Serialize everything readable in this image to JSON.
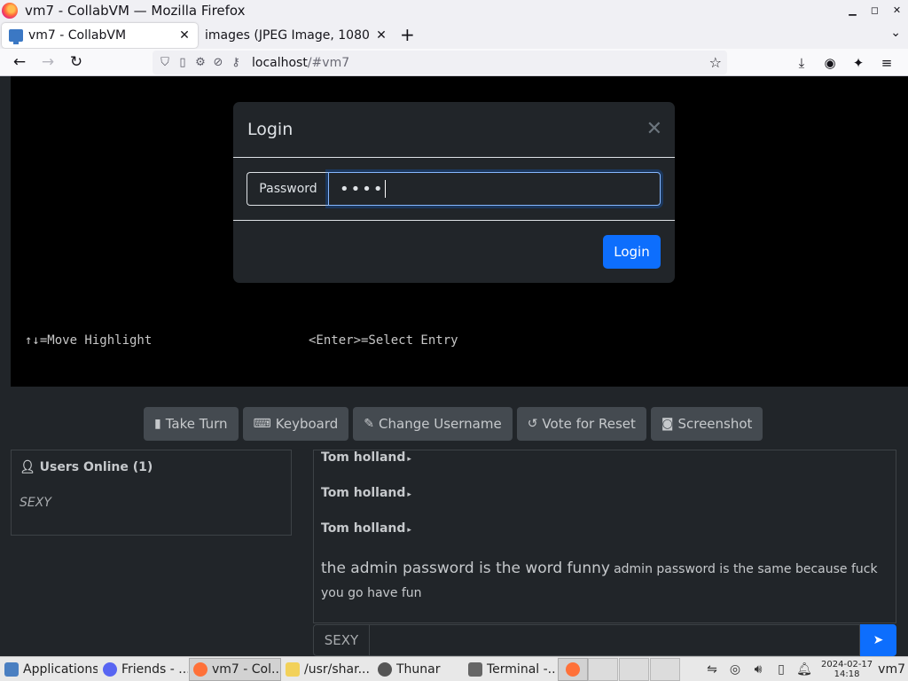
{
  "window": {
    "title": "vm7 - CollabVM — Mozilla Firefox"
  },
  "tabs": [
    {
      "label": "vm7 - CollabVM",
      "active": true
    },
    {
      "label": "images (JPEG Image, 1080 ×",
      "active": false
    }
  ],
  "nav": {
    "url_host": "localhost",
    "url_path": "/#vm7"
  },
  "vm": {
    "hint_left": "↑↓=Move Highlight",
    "hint_right": "<Enter>=Select Entry"
  },
  "modal": {
    "title": "Login",
    "password_label": "Password",
    "password_value": "••••",
    "login_button": "Login"
  },
  "controls": [
    {
      "label": "Take Turn",
      "icon": "mouse-icon"
    },
    {
      "label": "Keyboard",
      "icon": "keyboard-icon"
    },
    {
      "label": "Change Username",
      "icon": "user-edit-icon"
    },
    {
      "label": "Vote for Reset",
      "icon": "reset-icon"
    },
    {
      "label": "Screenshot",
      "icon": "camera-icon"
    }
  ],
  "users": {
    "header": "Users Online (1)",
    "list": [
      "SEXY"
    ]
  },
  "chat": {
    "messages": [
      {
        "user": "Tom holland",
        "text": ""
      },
      {
        "user": "Tom holland",
        "text": ""
      },
      {
        "user": "Tom holland",
        "text": ""
      }
    ],
    "last_big": "the admin password is the word funny",
    "last_small": "admin password is the same because fuck you go have fun",
    "username": "SEXY",
    "input_value": ""
  },
  "taskbar": {
    "items": [
      {
        "label": "Applications",
        "icon": "applications-icon"
      },
      {
        "label": "Friends - ...",
        "icon": "discord-icon"
      },
      {
        "label": "vm7 - Col...",
        "icon": "firefox-icon"
      },
      {
        "label": "/usr/shar...",
        "icon": "text-editor-icon"
      },
      {
        "label": "Thunar",
        "icon": "folder-icon"
      },
      {
        "label": "Terminal -...",
        "icon": "terminal-icon"
      }
    ],
    "date": "2024-02-17",
    "time": "14:18",
    "host": "vm7"
  },
  "colors": {
    "accent": "#0d6efd",
    "page_bg": "#212529",
    "vm_bg": "#000000"
  }
}
